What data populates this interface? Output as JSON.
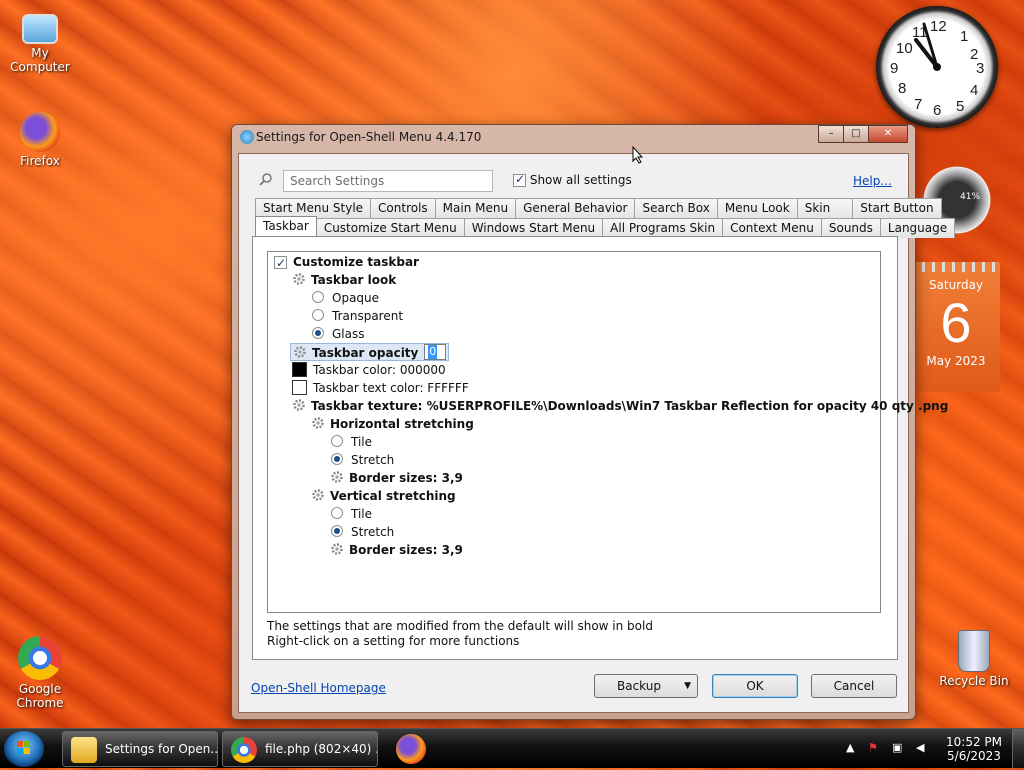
{
  "desktop": {
    "icons": [
      {
        "label": "My Computer"
      },
      {
        "label": "Firefox"
      },
      {
        "label": "Google Chrome"
      },
      {
        "label": "Recycle Bin"
      }
    ],
    "calendar": {
      "weekday": "Saturday",
      "day": "6",
      "month_year": "May 2023"
    },
    "meter_readouts": {
      "cpu": "41%"
    }
  },
  "dialog": {
    "title": "Settings for Open-Shell Menu 4.4.170",
    "search_placeholder": "Search Settings",
    "show_all_label": "Show all settings",
    "show_all_checked": true,
    "help_link": "Help...",
    "tabs_row1": [
      "Start Menu Style",
      "Controls",
      "Main Menu",
      "General Behavior",
      "Search Box",
      "Menu Look",
      "Skin",
      "Start Button"
    ],
    "tabs_row2": [
      "Taskbar",
      "Customize Start Menu",
      "Windows Start Menu",
      "All Programs Skin",
      "Context Menu",
      "Sounds",
      "Language"
    ],
    "active_tab": "Taskbar",
    "tree": {
      "customize_taskbar": "Customize taskbar",
      "taskbar_look": "Taskbar look",
      "opaque": "Opaque",
      "transparent": "Transparent",
      "glass": "Glass",
      "taskbar_opacity": "Taskbar opacity",
      "opacity_value": "0",
      "taskbar_color": "Taskbar color: 000000",
      "taskbar_text_color": "Taskbar text color: FFFFFF",
      "taskbar_texture": "Taskbar texture: %USERPROFILE%\\Downloads\\Win7 Taskbar Reflection for opacity 40 qty .png",
      "horizontal_stretching": "Horizontal stretching",
      "h_tile": "Tile",
      "h_stretch": "Stretch",
      "h_border": "Border sizes: 3,9",
      "vertical_stretching": "Vertical stretching",
      "v_tile": "Tile",
      "v_stretch": "Stretch",
      "v_border": "Border sizes: 3,9"
    },
    "hint1": "The settings that are modified from the default will show in bold",
    "hint2": "Right-click on a setting for more functions",
    "homepage_link": "Open-Shell Homepage",
    "backup_label": "Backup",
    "ok_label": "OK",
    "cancel_label": "Cancel"
  },
  "taskbar": {
    "buttons": [
      {
        "label": "Settings for Open..."
      },
      {
        "label": "file.php (802×40) ..."
      }
    ],
    "time": "10:52 PM",
    "date": "5/6/2023"
  },
  "colors": {
    "taskbar_color_swatch": "#000000",
    "taskbar_text_color_swatch": "#FFFFFF",
    "link": "#0645ad"
  }
}
